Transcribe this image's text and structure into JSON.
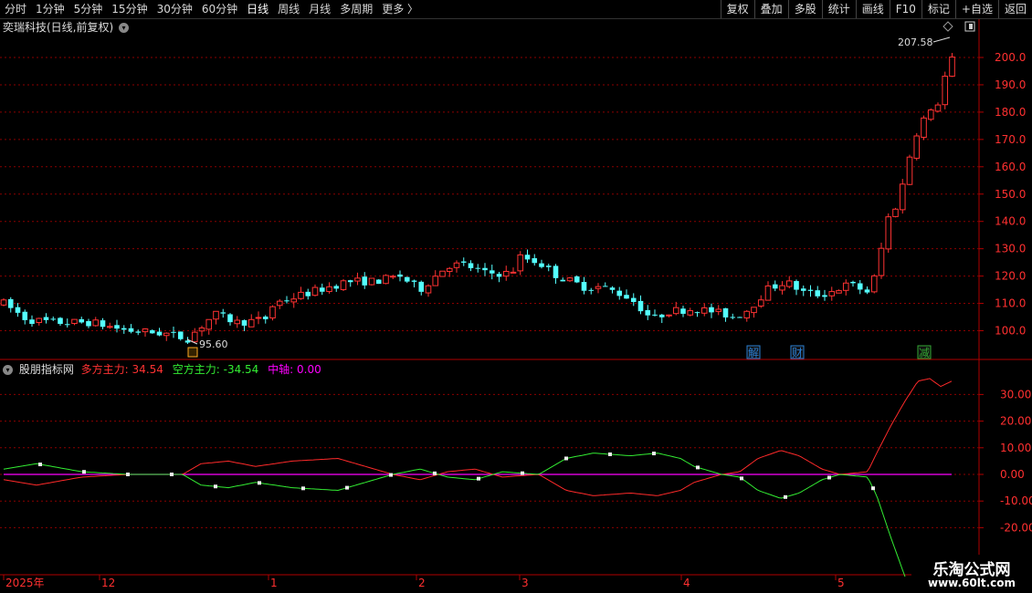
{
  "toolbar": {
    "periods": [
      "分时",
      "1分钟",
      "5分钟",
      "15分钟",
      "30分钟",
      "60分钟",
      "日线",
      "周线",
      "月线",
      "多周期",
      "更多"
    ],
    "active_period": "日线",
    "right_buttons": [
      "复权",
      "叠加",
      "多股",
      "统计",
      "画线",
      "F10",
      "标记",
      "+自选",
      "返回"
    ]
  },
  "main_chart": {
    "title": "奕瑞科技(日线,前复权)",
    "high_label": "207.58",
    "low_label": "95.60",
    "price_ticks": [
      "200.0",
      "190.0",
      "180.0",
      "170.0",
      "160.0",
      "150.0",
      "140.0",
      "130.0",
      "120.0",
      "110.0",
      "100.0"
    ],
    "event_markers": [
      "解",
      "财",
      "减"
    ]
  },
  "indicator": {
    "name": "股朋指标网",
    "line1_label": "多方主力:",
    "line1_value": "34.54",
    "line2_label": "空方主力:",
    "line2_value": "-34.54",
    "line3_label": "中轴:",
    "line3_value": "0.00",
    "ticks": [
      "30.00",
      "20.00",
      "10.00",
      "0.00",
      "-10.00",
      "-20.00"
    ]
  },
  "time_axis": [
    "2025年",
    "12",
    "1",
    "2",
    "3",
    "4",
    "5"
  ],
  "watermark": {
    "title": "乐淘公式网",
    "url": "www.60lt.com"
  },
  "colors": {
    "up": "#ff3232",
    "down": "#54ffff",
    "line_up": "#ff2a2a",
    "line_down": "#33ee33",
    "axis_mid": "#ff00ff",
    "grid": "#8b0000"
  }
}
